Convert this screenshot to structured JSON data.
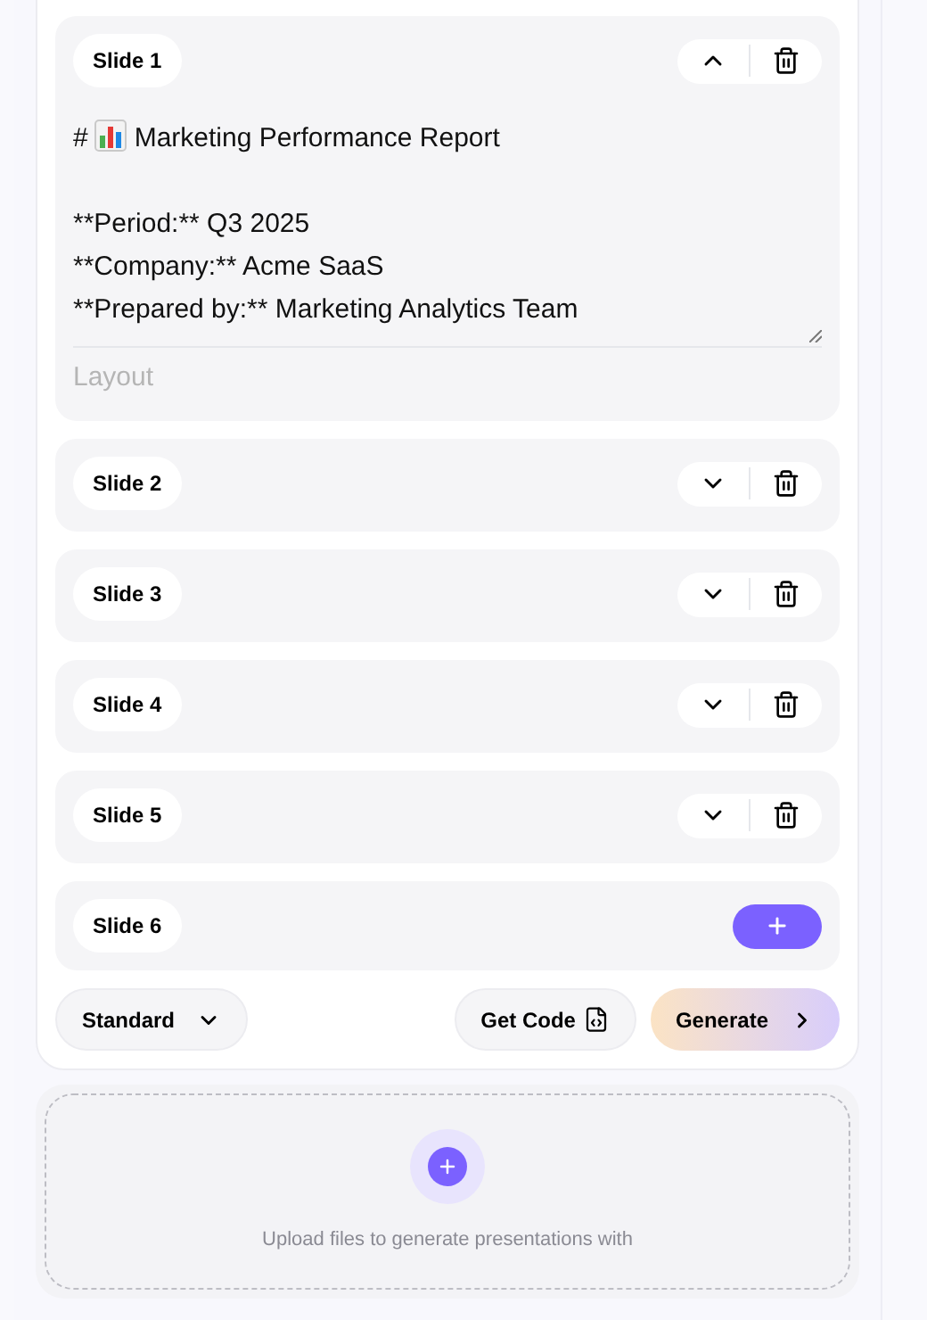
{
  "slides": [
    {
      "kind": "slide",
      "label": "Slide 1",
      "expanded": true,
      "heading_prefix": "#",
      "heading": "Marketing Performance Report",
      "lines": [
        "**Period:** Q3 2025",
        "**Company:** Acme SaaS",
        "**Prepared by:** Marketing Analytics Team"
      ],
      "layout_placeholder": "Layout"
    },
    {
      "kind": "slide",
      "label": "Slide 2",
      "expanded": false
    },
    {
      "kind": "slide",
      "label": "Slide 3",
      "expanded": false
    },
    {
      "kind": "slide",
      "label": "Slide 4",
      "expanded": false
    },
    {
      "kind": "slide",
      "label": "Slide 5",
      "expanded": false
    },
    {
      "kind": "add",
      "label": "Slide 6"
    }
  ],
  "footer": {
    "mode": "Standard",
    "get_code": "Get Code",
    "generate": "Generate"
  },
  "upload": {
    "text": "Upload files to generate presentations with"
  }
}
